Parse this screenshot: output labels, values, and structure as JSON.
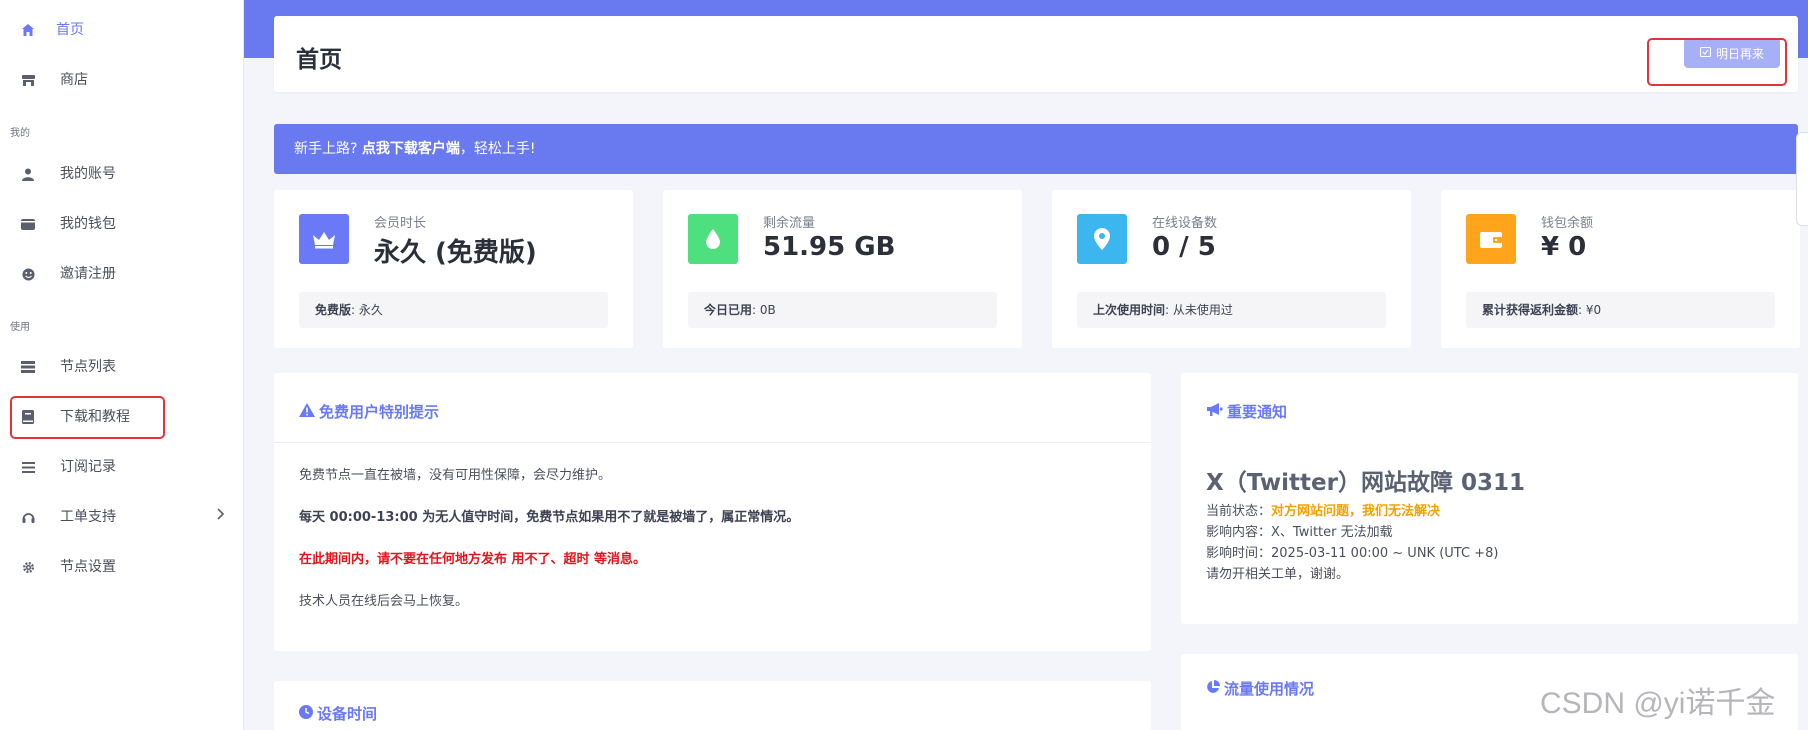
{
  "sidebar": {
    "items": [
      {
        "label": "首页",
        "icon": "home-icon"
      },
      {
        "label": "商店",
        "icon": "store-icon"
      },
      {
        "label": "我的账号",
        "icon": "user-icon"
      },
      {
        "label": "我的钱包",
        "icon": "wallet-icon"
      },
      {
        "label": "邀请注册",
        "icon": "smile-icon"
      },
      {
        "label": "节点列表",
        "icon": "server-icon"
      },
      {
        "label": "下载和教程",
        "icon": "book-icon"
      },
      {
        "label": "订阅记录",
        "icon": "list-icon"
      },
      {
        "label": "工单支持",
        "icon": "headset-icon"
      },
      {
        "label": "节点设置",
        "icon": "gear-icon"
      }
    ],
    "sections": {
      "mine": "我的",
      "use": "使用"
    }
  },
  "header": {
    "title": "首页",
    "tomorrow_button": "明日再来"
  },
  "banner": {
    "prefix": "新手上路?",
    "link": "点我下载客户端",
    "suffix": "，轻松上手!"
  },
  "stats": [
    {
      "label": "会员时长",
      "value": "永久 (免费版)",
      "foot_key": "免费版",
      "foot_val": ": 永久",
      "color": "#6979f8",
      "icon": "crown-icon"
    },
    {
      "label": "剩余流量",
      "value": "51.95 GB",
      "foot_key": "今日已用",
      "foot_val": ": 0B",
      "color": "#4ee07f",
      "icon": "droplet-icon"
    },
    {
      "label": "在线设备数",
      "value": "0 / 5",
      "foot_key": "上次使用时间",
      "foot_val": ": 从未使用过",
      "color": "#3bb6ef",
      "icon": "map-pin-icon"
    },
    {
      "label": "钱包余额",
      "value": "¥ 0",
      "foot_key": "累计获得返利金额",
      "foot_val": ": ¥0",
      "color": "#ffa41b",
      "icon": "wallet-icon"
    }
  ],
  "free_notice": {
    "title": "免费用户特别提示",
    "line1": "免费节点一直在被墙，没有可用性保障，会尽力维护。",
    "line2": "每天 00:00-13:00 为无人值守时间，免费节点如果用不了就是被墙了，属正常情况。",
    "line3": "在此期间内，请不要在任何地方发布 用不了、超时 等消息。",
    "line4": "技术人员在线后会马上恢复。"
  },
  "important_notice": {
    "title": "重要通知",
    "headline": "X（Twitter）网站故障 0311",
    "status_label": "当前状态：",
    "status_value": "对方网站问题，我们无法解决",
    "impact": "影响内容：X、Twitter 无法加载",
    "time": "影响时间：2025-03-11 00:00 ~ UNK (UTC +8)",
    "note": "请勿开相关工单，谢谢。"
  },
  "device_time": {
    "title": "设备时间"
  },
  "traffic_usage": {
    "title": "流量使用情况"
  },
  "watermark": "CSDN @yi诺千金"
}
